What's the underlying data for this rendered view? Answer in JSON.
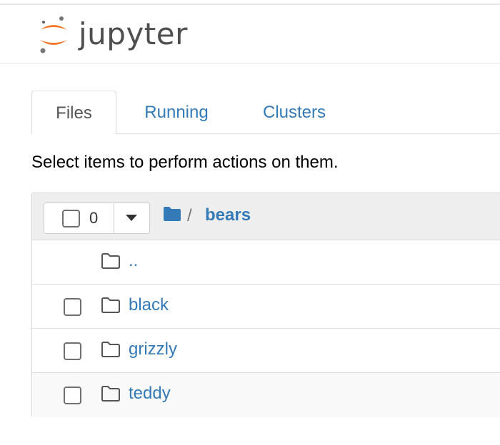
{
  "header": {
    "logo_text": "jupyter",
    "logo_icon": "jupyter-logo-icon",
    "logo_color": "#f37726"
  },
  "tabs": [
    {
      "label": "Files",
      "active": true
    },
    {
      "label": "Running",
      "active": false
    },
    {
      "label": "Clusters",
      "active": false
    }
  ],
  "hint": "Select items to perform actions on them.",
  "toolbar": {
    "selected_count": "0",
    "caret_icon": "caret-down-icon"
  },
  "breadcrumb": {
    "root_icon": "folder-icon",
    "separator": "/",
    "current": "bears"
  },
  "items": [
    {
      "name": "..",
      "type": "folder",
      "checkbox": false
    },
    {
      "name": "black",
      "type": "folder",
      "checkbox": true
    },
    {
      "name": "grizzly",
      "type": "folder",
      "checkbox": true
    },
    {
      "name": "teddy",
      "type": "folder",
      "checkbox": true
    }
  ],
  "colors": {
    "link": "#337ab7",
    "tab_active_text": "#555555",
    "panel_head_bg": "#eeeeee"
  }
}
